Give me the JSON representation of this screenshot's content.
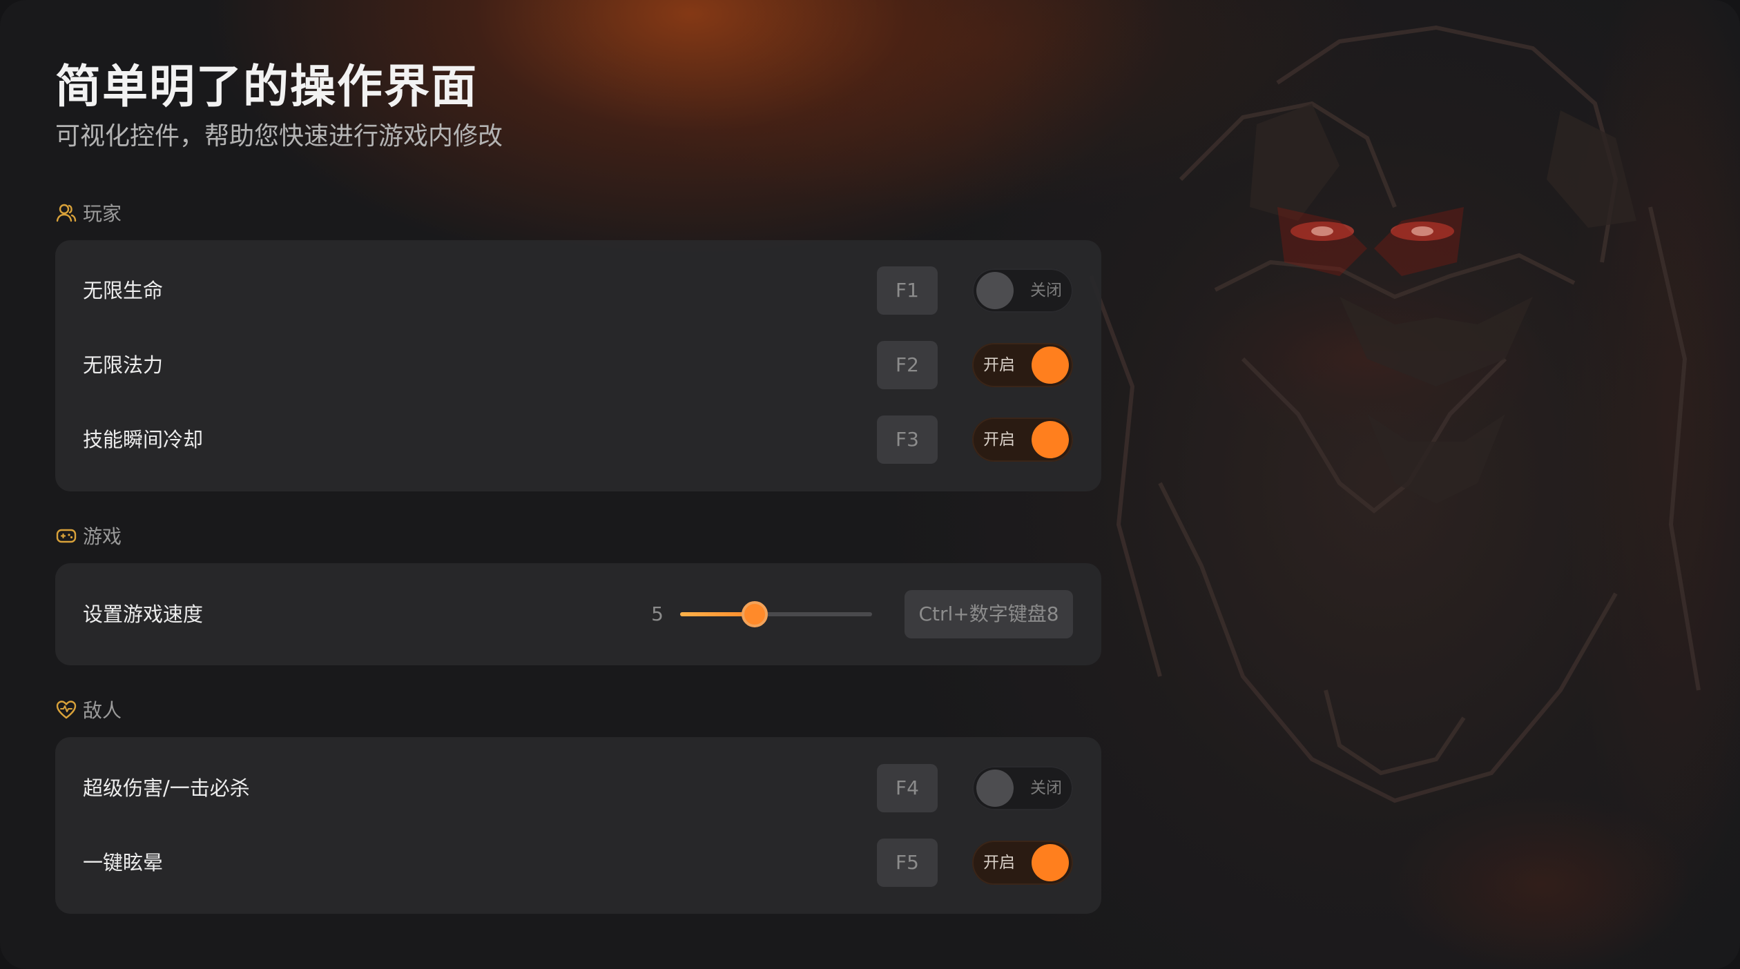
{
  "header": {
    "title": "简单明了的操作界面",
    "subtitle": "可视化控件，帮助您快速进行游戏内修改"
  },
  "colors": {
    "accent": "#ff7f1e",
    "icon_gold": "#d9a23a",
    "card_bg": "#28282a"
  },
  "sections": {
    "player": {
      "label": "玩家",
      "icon": "user-icon",
      "rows": [
        {
          "label": "无限生命",
          "hotkey": "F1",
          "toggle_state": "off",
          "toggle_label": "关闭"
        },
        {
          "label": "无限法力",
          "hotkey": "F2",
          "toggle_state": "on",
          "toggle_label": "开启"
        },
        {
          "label": "技能瞬间冷却",
          "hotkey": "F3",
          "toggle_state": "on",
          "toggle_label": "开启"
        }
      ]
    },
    "game": {
      "label": "游戏",
      "icon": "gamepad-icon",
      "rows": [
        {
          "label": "设置游戏速度",
          "value": "5",
          "slider_fraction": 0.39,
          "hotkey": "Ctrl+数字键盘8"
        }
      ]
    },
    "enemy": {
      "label": "敌人",
      "icon": "heart-pulse-icon",
      "rows": [
        {
          "label": "超级伤害/一击必杀",
          "hotkey": "F4",
          "toggle_state": "off",
          "toggle_label": "关闭"
        },
        {
          "label": "一键眩晕",
          "hotkey": "F5",
          "toggle_state": "on",
          "toggle_label": "开启"
        }
      ]
    }
  }
}
